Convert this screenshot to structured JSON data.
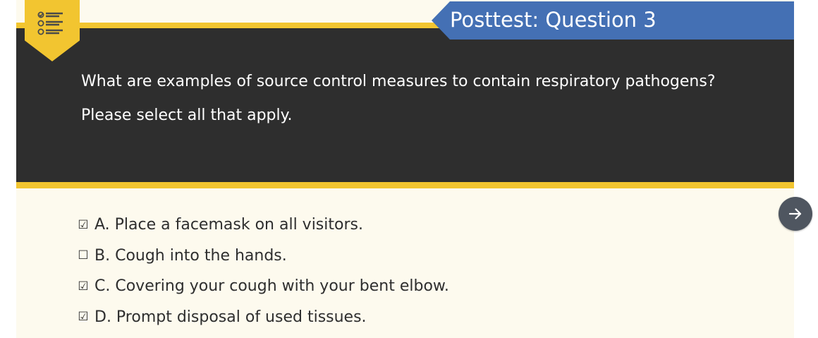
{
  "header": {
    "title": "Posttest: Question 3",
    "badge_icon": "checklist-icon",
    "accent_color": "#f2c530",
    "banner_color": "#4470b4"
  },
  "question": {
    "line1": "What are examples of source control measures to contain respiratory pathogens?",
    "line2": "Please select all that apply."
  },
  "answers": [
    {
      "checked": true,
      "box": "☑",
      "label": "A. Place a facemask on all visitors."
    },
    {
      "checked": false,
      "box": "☐",
      "label": "B. Cough into the hands."
    },
    {
      "checked": true,
      "box": "☑",
      "label": "C. Covering your cough with your bent elbow."
    },
    {
      "checked": true,
      "box": "☑",
      "label": "D. Prompt disposal of used tissues."
    }
  ],
  "navigation": {
    "next_icon": "arrow-right-icon"
  }
}
